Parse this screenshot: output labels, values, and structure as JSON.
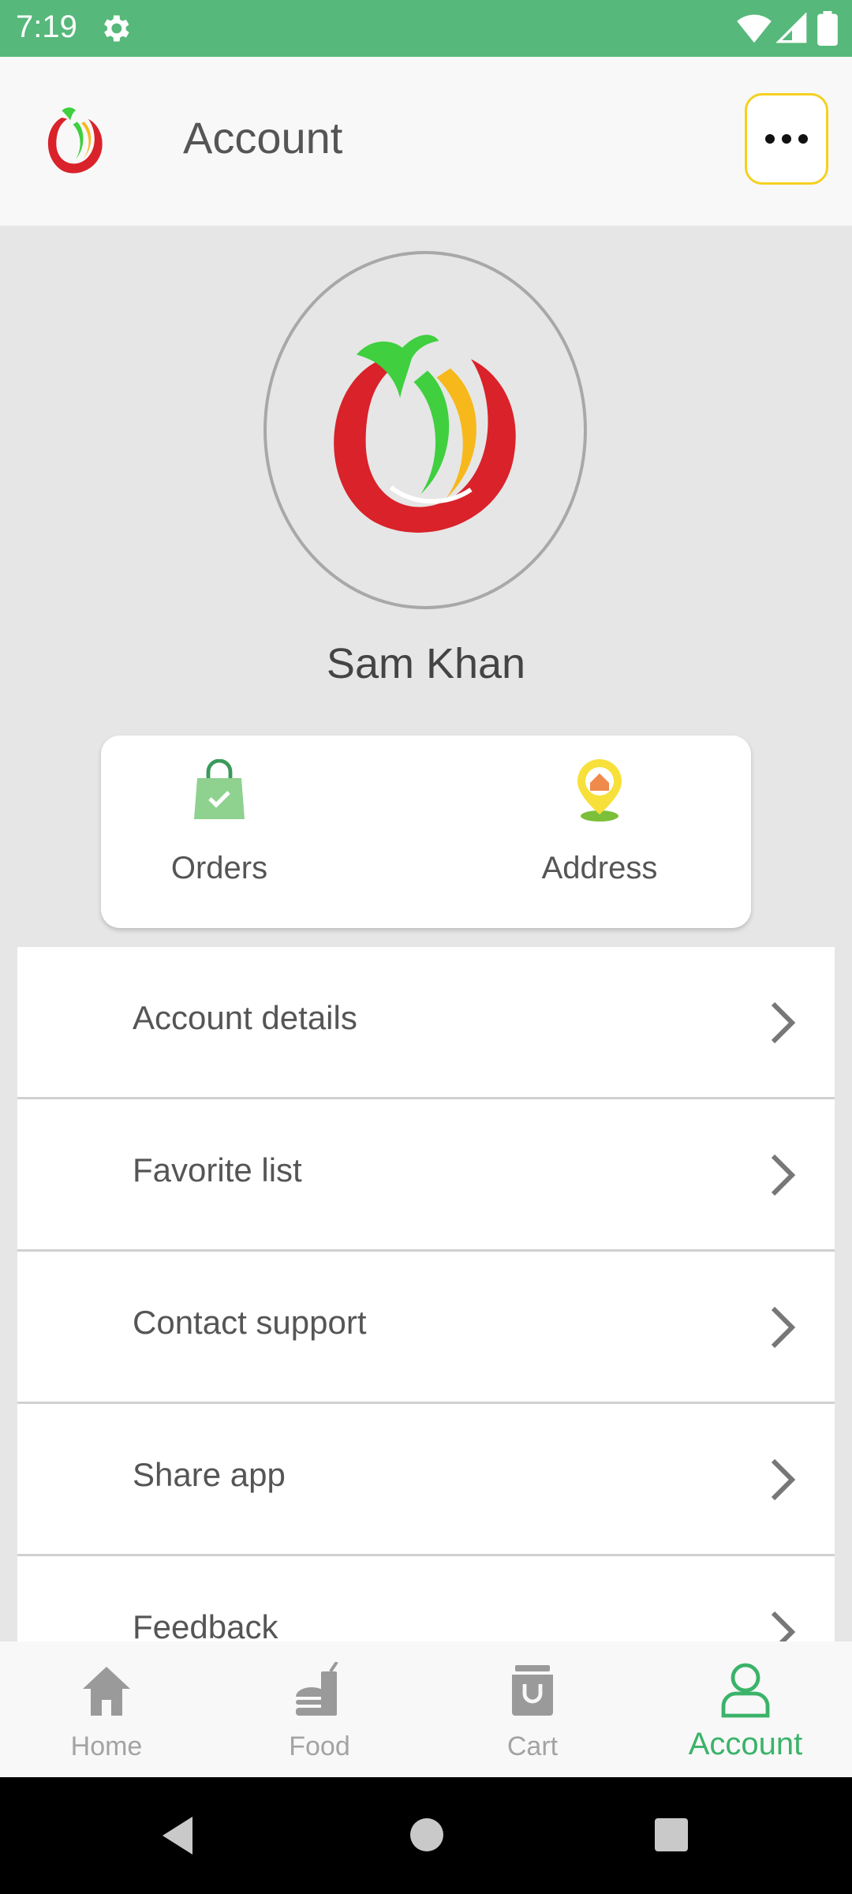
{
  "status_bar": {
    "time": "7:19"
  },
  "app_bar": {
    "title": "Account"
  },
  "profile": {
    "name": "Sam Khan"
  },
  "quick_actions": [
    {
      "label": "Orders",
      "icon": "shopping-bag-icon"
    },
    {
      "label": "Address",
      "icon": "location-pin-icon"
    }
  ],
  "menu": [
    {
      "label": "Account details"
    },
    {
      "label": "Favorite list"
    },
    {
      "label": "Contact support"
    },
    {
      "label": "Share app"
    },
    {
      "label": "Feedback"
    }
  ],
  "bottom_nav": [
    {
      "label": "Home",
      "icon": "home-icon",
      "active": false
    },
    {
      "label": "Food",
      "icon": "food-icon",
      "active": false
    },
    {
      "label": "Cart",
      "icon": "cart-icon",
      "active": false
    },
    {
      "label": "Account",
      "icon": "account-icon",
      "active": true
    }
  ],
  "colors": {
    "status_bar": "#56b87a",
    "accent": "#3bb36a",
    "more_border": "#f5d020",
    "logo_red": "#d9222a",
    "logo_green": "#3fcf3f",
    "logo_yellow": "#f7b81b"
  }
}
